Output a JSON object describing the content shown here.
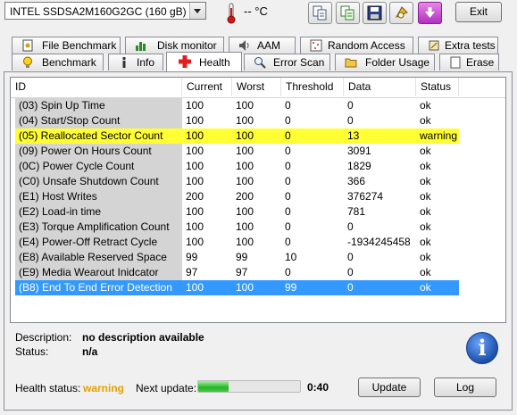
{
  "toolbar": {
    "drive": "INTEL SSDSA2M160G2GC (160 gB)",
    "temperature": "-- °C",
    "exit_label": "Exit"
  },
  "tabs_top": [
    {
      "label": "File Benchmark"
    },
    {
      "label": "Disk monitor"
    },
    {
      "label": "AAM"
    },
    {
      "label": "Random Access"
    },
    {
      "label": "Extra tests"
    }
  ],
  "tabs_bottom": [
    {
      "label": "Benchmark"
    },
    {
      "label": "Info"
    },
    {
      "label": "Health"
    },
    {
      "label": "Error Scan"
    },
    {
      "label": "Folder Usage"
    },
    {
      "label": "Erase"
    }
  ],
  "table": {
    "columns": [
      "ID",
      "Current",
      "Worst",
      "Threshold",
      "Data",
      "Status"
    ],
    "rows": [
      {
        "id": "(03) Spin Up Time",
        "current": "100",
        "worst": "100",
        "threshold": "0",
        "data": "0",
        "status": "ok"
      },
      {
        "id": "(04) Start/Stop Count",
        "current": "100",
        "worst": "100",
        "threshold": "0",
        "data": "0",
        "status": "ok"
      },
      {
        "id": "(05) Reallocated Sector Count",
        "current": "100",
        "worst": "100",
        "threshold": "0",
        "data": "13",
        "status": "warning"
      },
      {
        "id": "(09) Power On Hours Count",
        "current": "100",
        "worst": "100",
        "threshold": "0",
        "data": "3091",
        "status": "ok"
      },
      {
        "id": "(0C) Power Cycle Count",
        "current": "100",
        "worst": "100",
        "threshold": "0",
        "data": "1829",
        "status": "ok"
      },
      {
        "id": "(C0) Unsafe Shutdown Count",
        "current": "100",
        "worst": "100",
        "threshold": "0",
        "data": "366",
        "status": "ok"
      },
      {
        "id": "(E1) Host Writes",
        "current": "200",
        "worst": "200",
        "threshold": "0",
        "data": "376274",
        "status": "ok"
      },
      {
        "id": "(E2) Load-in time",
        "current": "100",
        "worst": "100",
        "threshold": "0",
        "data": "781",
        "status": "ok"
      },
      {
        "id": "(E3) Torque Amplification Count",
        "current": "100",
        "worst": "100",
        "threshold": "0",
        "data": "0",
        "status": "ok"
      },
      {
        "id": "(E4) Power-Off Retract Cycle",
        "current": "100",
        "worst": "100",
        "threshold": "0",
        "data": "-1934245458",
        "status": "ok"
      },
      {
        "id": "(E8) Available Reserved Space",
        "current": "99",
        "worst": "99",
        "threshold": "10",
        "data": "0",
        "status": "ok"
      },
      {
        "id": "(E9) Media Wearout Inidcator",
        "current": "97",
        "worst": "97",
        "threshold": "0",
        "data": "0",
        "status": "ok"
      },
      {
        "id": "(B8) End To End Error Detection",
        "current": "100",
        "worst": "100",
        "threshold": "99",
        "data": "0",
        "status": "ok"
      }
    ]
  },
  "details": {
    "description_label": "Description:",
    "description_value": "no description available",
    "status_label": "Status:",
    "status_value": "n/a"
  },
  "footer": {
    "health_label": "Health status:",
    "health_value": "warning",
    "next_update_label": "Next update:",
    "next_update_value": "0:40",
    "progress_fraction": 0.3,
    "update_label": "Update",
    "log_label": "Log"
  },
  "colors": {
    "warning_row": "#ffff33",
    "selected_row": "#3399ff",
    "health_warning_text": "#e6a000"
  }
}
